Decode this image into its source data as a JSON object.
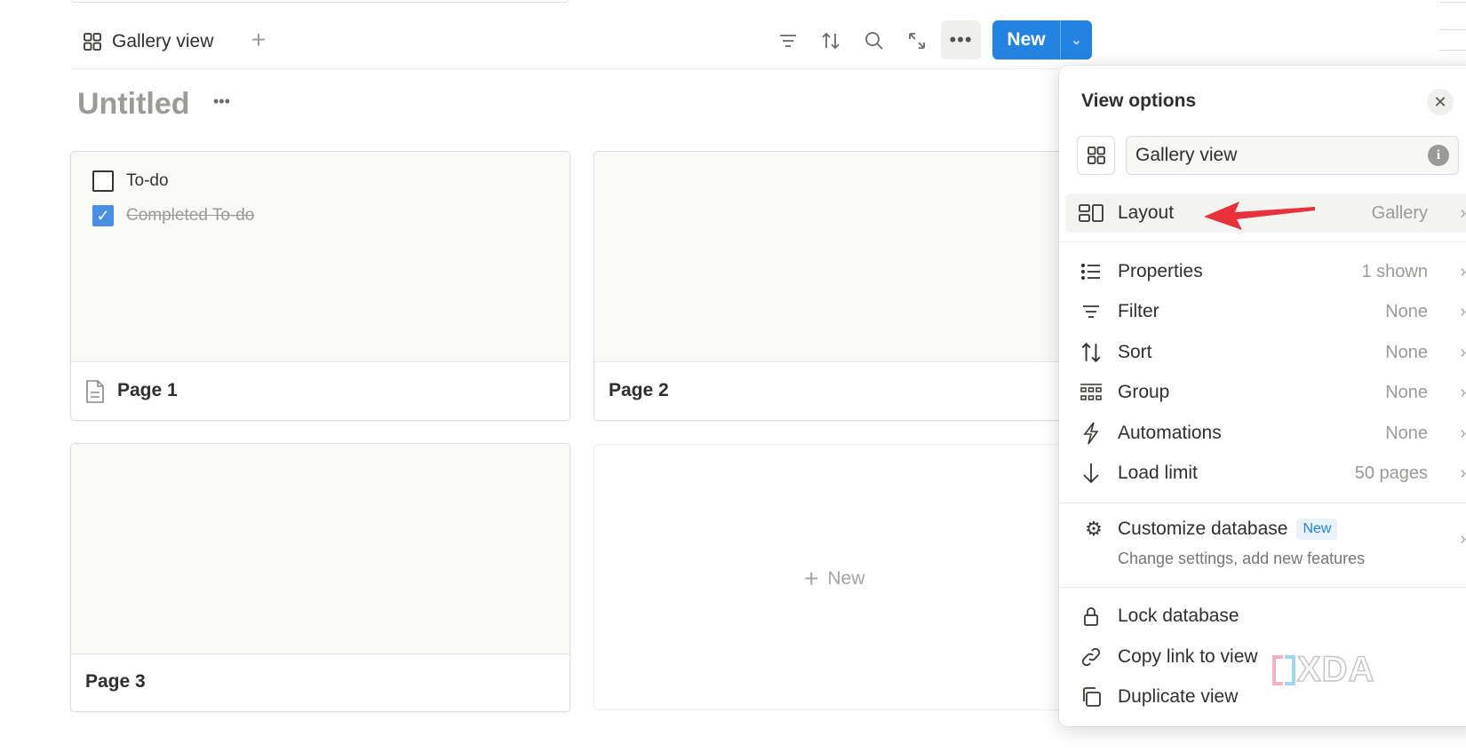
{
  "toolbar": {
    "view_tab_label": "Gallery view",
    "new_label": "New"
  },
  "page": {
    "title": "Untitled"
  },
  "cards": [
    {
      "title": "Page 1",
      "todos": [
        {
          "label": "To-do",
          "checked": false
        },
        {
          "label": "Completed To-do",
          "checked": true
        }
      ]
    },
    {
      "title": "Page 2"
    },
    {
      "title": "Page 3"
    }
  ],
  "new_card_label": "New",
  "view_options": {
    "title": "View options",
    "view_name": "Gallery view",
    "layout": {
      "label": "Layout",
      "value": "Gallery"
    },
    "settings": [
      {
        "label": "Properties",
        "value": "1 shown",
        "icon": "list-icon"
      },
      {
        "label": "Filter",
        "value": "None",
        "icon": "filter-icon"
      },
      {
        "label": "Sort",
        "value": "None",
        "icon": "sort-icon"
      },
      {
        "label": "Group",
        "value": "None",
        "icon": "group-icon"
      },
      {
        "label": "Automations",
        "value": "None",
        "icon": "lightning-icon"
      },
      {
        "label": "Load limit",
        "value": "50 pages",
        "icon": "arrow-down-icon"
      }
    ],
    "customize": {
      "label": "Customize database",
      "badge": "New",
      "subtitle": "Change settings, add new features"
    },
    "actions": [
      {
        "label": "Lock database",
        "icon": "lock-icon"
      },
      {
        "label": "Copy link to view",
        "icon": "link-icon"
      },
      {
        "label": "Duplicate view",
        "icon": "duplicate-icon"
      }
    ]
  },
  "watermark": "XDA",
  "colors": {
    "accent": "#2383e2",
    "arrow": "#e8313a",
    "checkbox": "#2383e2"
  }
}
